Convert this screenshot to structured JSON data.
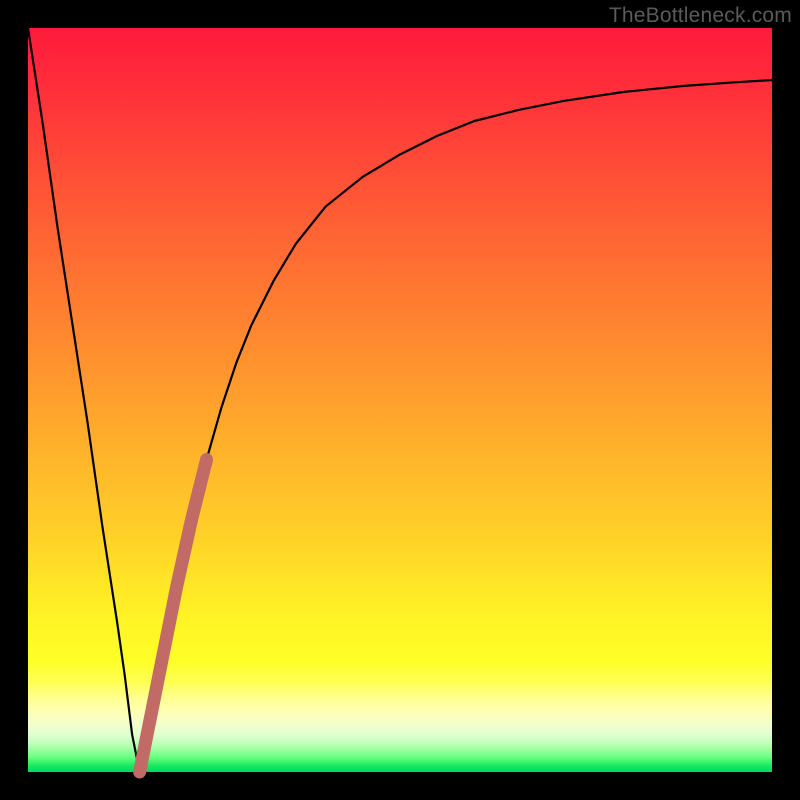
{
  "watermark": "TheBottleneck.com",
  "colors": {
    "frame": "#000000",
    "curve": "#000000",
    "marker": "#c26a66"
  },
  "chart_data": {
    "type": "line",
    "title": "",
    "xlabel": "",
    "ylabel": "",
    "xlim": [
      0,
      100
    ],
    "ylim": [
      0,
      100
    ],
    "series": [
      {
        "name": "bottleneck-curve",
        "x": [
          0,
          2,
          4,
          6,
          8,
          10,
          12,
          13,
          14,
          15,
          16,
          18,
          20,
          22,
          24,
          26,
          28,
          30,
          33,
          36,
          40,
          45,
          50,
          55,
          60,
          66,
          72,
          80,
          88,
          95,
          100
        ],
        "values": [
          100,
          87,
          73,
          60,
          47,
          33,
          20,
          13,
          5,
          0,
          5,
          15,
          25,
          34,
          42,
          49,
          55,
          60,
          66,
          71,
          76,
          80,
          83,
          85.5,
          87.5,
          89,
          90.2,
          91.4,
          92.2,
          92.7,
          93
        ]
      }
    ],
    "marker_segment": {
      "name": "highlighted-range",
      "x_start": 14.5,
      "x_end": 24,
      "note": "thick salmon overlay along rising limb"
    }
  }
}
